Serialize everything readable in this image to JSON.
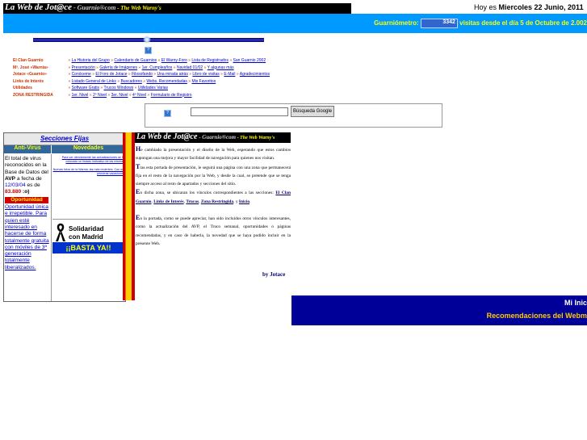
{
  "header": {
    "title": "La Web de Jot@ce",
    "site": " - Guarnio®com",
    "tagline": " - The Web Warny's",
    "date_prefix": "Hoy es ",
    "date": "Miercoles 22 Junio, 2011"
  },
  "counter": {
    "label": "Guarniómetro: ",
    "value": "3342",
    "suffix": " visitas desde el día 5 de Octubre de 2.002"
  },
  "search": {
    "button": "Búsqueda Google",
    "value": ""
  },
  "menu": [
    {
      "label": "El Clan Guarnio",
      "links": [
        "La Historia del Grupo",
        "Calendario de Guarnios",
        "El Warny-Foro",
        "Lista de Registrados",
        "San Guarnio 2002"
      ]
    },
    {
      "label": "Mª. José «Warnia»",
      "links": [
        "Presentación",
        "Galería de Imágenes",
        "1er. Cumpleaños",
        "Navidad 01/02",
        "Y algunas más"
      ]
    },
    {
      "label": "Jotace «Guarnio»",
      "links": [
        "Conóceme",
        "El Foro de Jotace",
        "Filosofando",
        "Una mirada atrás",
        "Libro de visitas",
        "E-Mail",
        "Agradecimientos"
      ]
    },
    {
      "label": "Links de Interés",
      "links": [
        "Listado General de Links",
        "Buscadores",
        "Webs. Recomendadas",
        "Mis Favoritos"
      ]
    },
    {
      "label": "Utilidades",
      "links": [
        "Software Gratis",
        "Trucos Windows",
        "Utilidades Varias"
      ]
    },
    {
      "label": "ZONA RESTRINGIDA",
      "links": [
        "1er. Nivel",
        "2º Nivel",
        "3er. Nivel",
        "4º Nivel",
        "Formulario de Registro"
      ]
    }
  ],
  "left_panel": {
    "heading": "Secciones Fijas",
    "col1_title": "Anti-Virus",
    "col2_title": "Novedades",
    "antivirus_text1": "El total de virus reconocidos en la Base de Datos del ",
    "antivirus_avp": "AVP",
    "antivirus_text2": " a fecha de ",
    "antivirus_date": "12/03/04",
    "antivirus_text3": " es de ",
    "antivirus_count": "83.880",
    "antivirus_smile": " :o)",
    "oportunidad_label": "Oportunidad",
    "oportunidad_text": "Oportunidad única e irrepetible. Para quien esté interesado en hacerse de forma totalmente gratuita con móviles de 3ª generación totalmente liberalizados.",
    "novedades_1": "Para ver directamente las actualizaciones se ha colocado un listado indicativo de las mismas.",
    "novedades_2": "Nuevas fotos de la Warnia; las más recientes. Con sus primeras vacaciones.",
    "solidaridad_line1": "Solidaridad",
    "solidaridad_line2": "con Madrid",
    "basta": "¡¡BASTA YA!!"
  },
  "main": {
    "title": "La Web de Jot@ce",
    "site": " - Guarnio®com",
    "tagline": " - The Web Warny's",
    "p1_cap": "H",
    "p1": "e cambiado la presentación y el diseño de la Web, esperando que estos cambios supongan una mejora y mayor facilidad de navegación para quienes nos visitan.",
    "p2_cap": "T",
    "p2": "ras esta portada de presentación, le seguirá una página con una zona que permanecerá fija en el resto de la navegación por la Web, y desde la cual, se pretende que se tenga siempre acceso al resto de apartados y secciones del sitio.",
    "p3_cap": "E",
    "p3_a": "n dicha zona, se ubicaran los vínculos correspondientes a las secciones: ",
    "p3_links": [
      "El Clan Guarnio",
      "Links de Interés",
      "Trucos",
      "Zona Restringida",
      "Inicio"
    ],
    "p4_cap": "E",
    "p4": "n la portada, como se puede apreciar, han sido incluidos otros vínculos interesantes, como la actualización del AVP, el Truco semanal, oportunidades o páginas recomendadas, y en caso de haberla, la novedad que se haya podido incluir en la presente Web.",
    "byline": "by Jotace"
  },
  "bottom": {
    "mi_inicio": "Mi Inic",
    "recomendaciones": "Recomendaciones del Webm"
  }
}
